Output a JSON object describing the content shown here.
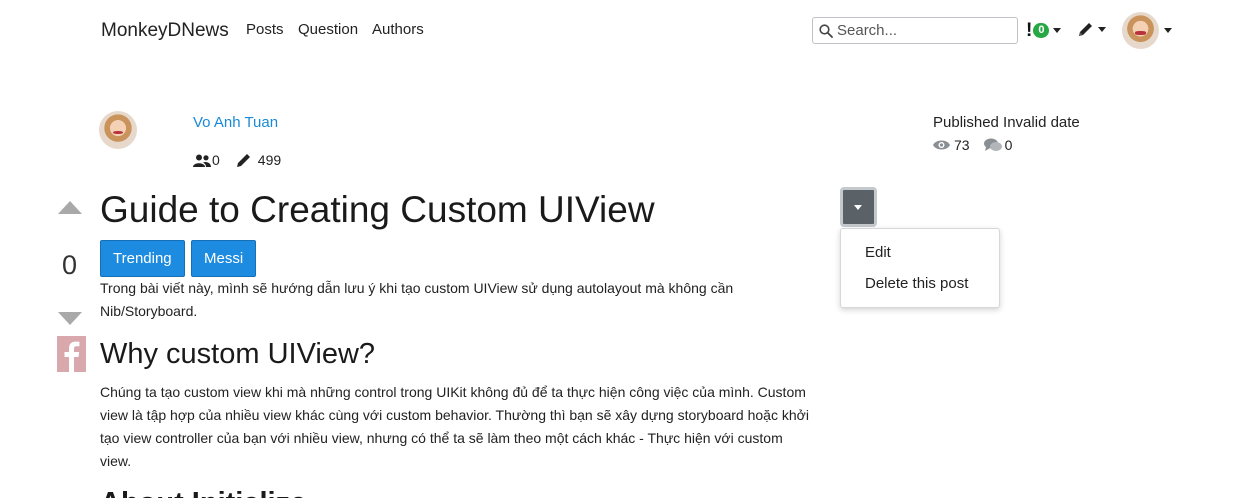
{
  "navbar": {
    "brand": "MonkeyDNews",
    "links": [
      {
        "label": "Posts"
      },
      {
        "label": "Question"
      },
      {
        "label": "Authors"
      }
    ],
    "search": {
      "placeholder": "Search...",
      "value": ""
    },
    "notifications": {
      "mark": "!",
      "count": "0"
    }
  },
  "post": {
    "author": {
      "name": "Vo Anh Tuan",
      "followers": "0",
      "posts": "499"
    },
    "published": "Published Invalid date",
    "views": "73",
    "comments": "0",
    "votes": "0",
    "title": "Guide to Creating Custom UIView",
    "tags": [
      "Trending",
      "Messi"
    ],
    "intro": "Trong bài viết này, mình sẽ hướng dẫn lưu ý khi tạo custom UIView sử dụng autolayout mà không cần Nib/Storyboard.",
    "section1_heading": "Why custom UIView?",
    "section1_body": "Chúng ta tạo custom view khi mà những control trong UIKit không đủ để ta thực hiện công việc của mình. Custom view là tập hợp của nhiều view khác cùng với custom behavior. Thường thì bạn sẽ xây dựng storyboard hoặc khởi tạo view controller của bạn với nhiều view, nhưng có thể ta sẽ làm theo một cách khác - Thực hiện với custom view.",
    "section2_heading": "About Initialize"
  },
  "actions_menu": {
    "items": [
      "Edit",
      "Delete this post"
    ]
  },
  "colors": {
    "link": "#1a8ad6",
    "tag_bg": "#1d8be0",
    "badge": "#28a745",
    "toggle_bg": "#5a6268"
  },
  "icons": [
    "search-icon",
    "followers-icon",
    "pencil-icon",
    "eye-icon",
    "comments-icon",
    "facebook-icon",
    "caret-down-icon",
    "arrow-up-icon",
    "arrow-down-icon"
  ]
}
